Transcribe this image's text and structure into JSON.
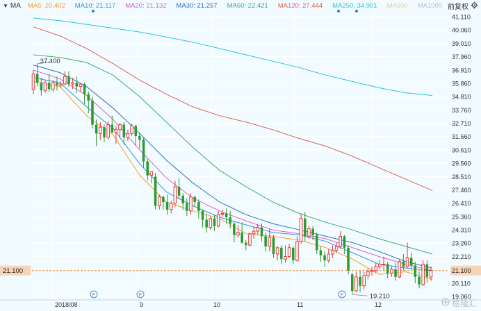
{
  "header": {
    "ma_label": "MA",
    "settings_label": "前复权",
    "legend": [
      {
        "label": "MA5: 20.402",
        "color": "#f3a02a"
      },
      {
        "label": "MA10: 21.117",
        "color": "#3a8fd9"
      },
      {
        "label": "MA20: 21.132",
        "color": "#d65fd0"
      },
      {
        "label": "MA30: 21.257",
        "color": "#2a6fb8"
      },
      {
        "label": "MA60: 22.421",
        "color": "#3dae6a"
      },
      {
        "label": "MA120: 27.444",
        "color": "#e06055"
      },
      {
        "label": "MA250: 34.901",
        "color": "#26c6d9"
      },
      {
        "label": "MA500",
        "color": "#e9d38a"
      },
      {
        "label": "MA1000",
        "color": "#b9b9e3"
      }
    ]
  },
  "watermark": "格隆汇",
  "chart_data": {
    "type": "candlestick",
    "title": "",
    "y_ticks": [
      41.11,
      40.06,
      39.01,
      37.96,
      36.91,
      35.86,
      34.81,
      33.76,
      32.71,
      31.66,
      30.61,
      29.56,
      28.51,
      27.46,
      26.41,
      25.36,
      24.31,
      23.26,
      22.21,
      20.11,
      19.06
    ],
    "y_tick_labels": [
      "41.110",
      "40.060",
      "39.010",
      "37.960",
      "36.910",
      "35.860",
      "34.810",
      "33.760",
      "32.710",
      "31.660",
      "30.610",
      "29.560",
      "28.510",
      "27.460",
      "26.410",
      "25.360",
      "24.310",
      "23.260",
      "22.210",
      "20.110",
      "19.060"
    ],
    "ylim": [
      18.9,
      41.2
    ],
    "x_labels": [
      "2018/08",
      "9",
      "10",
      "11",
      "12"
    ],
    "current_price": {
      "value": 21.1,
      "label": "21.100",
      "color": "#f08a28"
    },
    "annotations": [
      {
        "label": "37.400",
        "type": "high",
        "value": 37.4
      },
      {
        "label": "19.210",
        "type": "low",
        "value": 19.21
      }
    ],
    "event_markers": [
      "E",
      "E",
      "E"
    ],
    "colors": {
      "up": "#e2353a",
      "down": "#2c9a2c",
      "grid": "#ffffff",
      "bg": "#f2fbff",
      "cur_line": "#f08a28"
    },
    "candles": [
      [
        35.4,
        36.9,
        36.6,
        35.0
      ],
      [
        36.6,
        37.4,
        35.9,
        35.6
      ],
      [
        35.9,
        36.3,
        35.3,
        34.9
      ],
      [
        35.3,
        36.1,
        35.9,
        35.1
      ],
      [
        35.9,
        36.6,
        35.4,
        35.2
      ],
      [
        35.4,
        36.1,
        35.9,
        35.2
      ],
      [
        35.9,
        36.4,
        35.7,
        35.3
      ],
      [
        35.7,
        36.0,
        35.8,
        35.5
      ],
      [
        35.8,
        36.8,
        36.4,
        35.7
      ],
      [
        36.4,
        36.8,
        35.8,
        35.6
      ],
      [
        35.8,
        36.3,
        35.9,
        35.4
      ],
      [
        35.9,
        36.4,
        35.6,
        35.1
      ],
      [
        35.6,
        35.9,
        35.8,
        35.2
      ],
      [
        35.8,
        35.9,
        35.0,
        34.2
      ],
      [
        35.0,
        35.2,
        34.5,
        33.5
      ],
      [
        34.5,
        34.8,
        32.6,
        32.3
      ],
      [
        32.6,
        33.0,
        31.9,
        30.9
      ],
      [
        31.9,
        32.8,
        32.4,
        31.4
      ],
      [
        32.4,
        32.6,
        31.6,
        31.2
      ],
      [
        31.6,
        32.9,
        32.6,
        31.4
      ],
      [
        32.6,
        33.3,
        32.0,
        31.9
      ],
      [
        32.0,
        32.5,
        32.2,
        31.1
      ],
      [
        32.2,
        32.7,
        32.6,
        31.6
      ],
      [
        32.6,
        32.8,
        31.6,
        31.0
      ],
      [
        31.6,
        32.2,
        31.9,
        31.3
      ],
      [
        31.9,
        32.7,
        32.5,
        31.7
      ],
      [
        32.5,
        32.6,
        31.7,
        30.9
      ],
      [
        31.7,
        32.0,
        31.4,
        30.7
      ],
      [
        31.4,
        31.6,
        29.7,
        29.2
      ],
      [
        29.7,
        29.9,
        28.6,
        28.2
      ],
      [
        28.6,
        28.8,
        28.9,
        28.0
      ],
      [
        28.5,
        28.8,
        26.2,
        25.9
      ],
      [
        26.2,
        27.1,
        26.9,
        25.9
      ],
      [
        26.9,
        27.0,
        26.5,
        25.9
      ],
      [
        26.5,
        27.1,
        25.9,
        25.5
      ],
      [
        25.9,
        26.6,
        26.4,
        25.6
      ],
      [
        26.4,
        28.2,
        27.7,
        26.1
      ],
      [
        27.7,
        28.4,
        27.0,
        26.7
      ],
      [
        27.0,
        27.2,
        26.4,
        25.9
      ],
      [
        26.4,
        26.8,
        25.8,
        25.4
      ],
      [
        25.8,
        27.2,
        26.9,
        25.5
      ],
      [
        26.9,
        27.0,
        26.5,
        26.1
      ],
      [
        26.5,
        26.7,
        25.8,
        25.2
      ],
      [
        25.8,
        25.9,
        25.1,
        24.5
      ],
      [
        25.1,
        25.6,
        24.5,
        24.1
      ],
      [
        24.5,
        25.4,
        25.2,
        24.3
      ],
      [
        25.2,
        25.5,
        24.6,
        24.2
      ],
      [
        24.6,
        25.8,
        25.5,
        24.5
      ],
      [
        25.5,
        25.9,
        25.6,
        25.3
      ],
      [
        25.6,
        26.0,
        25.3,
        24.8
      ],
      [
        25.3,
        25.8,
        24.8,
        24.4
      ],
      [
        24.8,
        25.0,
        23.9,
        23.3
      ],
      [
        23.9,
        24.7,
        24.1,
        23.7
      ],
      [
        24.1,
        24.9,
        23.3,
        23.2
      ],
      [
        23.3,
        23.5,
        23.1,
        22.7
      ],
      [
        23.1,
        24.1,
        24.0,
        23.0
      ],
      [
        24.0,
        24.6,
        24.2,
        23.6
      ],
      [
        24.2,
        24.8,
        24.5,
        23.9
      ],
      [
        24.5,
        24.8,
        23.8,
        23.4
      ],
      [
        23.8,
        24.1,
        23.0,
        22.6
      ],
      [
        23.0,
        24.4,
        23.7,
        22.6
      ],
      [
        23.7,
        23.9,
        22.4,
        22.1
      ],
      [
        22.4,
        23.0,
        22.9,
        21.9
      ],
      [
        22.9,
        23.1,
        22.0,
        21.6
      ],
      [
        22.0,
        23.1,
        22.2,
        21.7
      ],
      [
        22.2,
        23.2,
        22.9,
        22.1
      ],
      [
        22.9,
        23.0,
        21.9,
        21.6
      ],
      [
        21.9,
        23.8,
        23.4,
        21.8
      ],
      [
        23.4,
        25.6,
        25.2,
        23.2
      ],
      [
        25.2,
        25.7,
        23.8,
        23.4
      ],
      [
        23.8,
        24.6,
        24.4,
        23.6
      ],
      [
        24.4,
        24.6,
        23.9,
        23.5
      ],
      [
        23.9,
        24.1,
        22.7,
        22.4
      ],
      [
        22.7,
        23.0,
        22.3,
        21.8
      ],
      [
        22.3,
        22.6,
        21.9,
        21.4
      ],
      [
        21.9,
        22.8,
        22.4,
        21.7
      ],
      [
        22.4,
        23.1,
        22.7,
        22.1
      ],
      [
        22.7,
        23.3,
        23.0,
        22.5
      ],
      [
        23.0,
        24.2,
        23.8,
        22.8
      ],
      [
        23.8,
        23.9,
        22.9,
        22.4
      ],
      [
        22.9,
        23.1,
        21.1,
        20.8
      ],
      [
        20.8,
        20.9,
        19.5,
        19.2
      ],
      [
        19.5,
        21.0,
        20.6,
        19.4
      ],
      [
        20.6,
        21.1,
        19.9,
        19.4
      ],
      [
        19.9,
        21.0,
        20.7,
        19.6
      ],
      [
        20.7,
        21.3,
        21.0,
        20.4
      ],
      [
        21.0,
        21.4,
        21.1,
        20.7
      ],
      [
        21.1,
        21.7,
        21.4,
        20.9
      ],
      [
        21.4,
        21.9,
        21.6,
        21.2
      ],
      [
        21.6,
        22.2,
        21.6,
        21.1
      ],
      [
        21.6,
        21.8,
        20.9,
        20.5
      ],
      [
        20.9,
        21.4,
        21.2,
        20.6
      ],
      [
        21.2,
        21.7,
        20.6,
        20.3
      ],
      [
        20.6,
        22.0,
        21.8,
        20.5
      ],
      [
        21.8,
        22.4,
        21.4,
        21.1
      ],
      [
        21.4,
        23.3,
        22.1,
        21.3
      ],
      [
        22.1,
        22.5,
        21.5,
        21.2
      ],
      [
        21.5,
        21.8,
        20.6,
        20.1
      ],
      [
        20.6,
        21.0,
        20.0,
        19.7
      ],
      [
        20.0,
        21.9,
        21.6,
        19.9
      ],
      [
        21.6,
        21.9,
        20.6,
        20.1
      ],
      [
        20.6,
        21.4,
        21.1,
        20.3
      ]
    ],
    "ma_series": [
      {
        "name": "MA250",
        "color": "#26c6d9",
        "values": [
          41.0,
          40.8,
          40.5,
          40.2,
          39.9,
          39.5,
          39.1,
          38.6,
          38.1,
          37.6,
          37.1,
          36.5,
          36.0,
          35.5,
          35.1,
          34.9
        ]
      },
      {
        "name": "MA120",
        "color": "#e06055",
        "values": [
          40.3,
          39.6,
          38.6,
          37.4,
          36.1,
          35.0,
          34.0,
          33.3,
          32.8,
          32.2,
          31.5,
          30.9,
          30.1,
          29.2,
          28.3,
          27.4
        ]
      },
      {
        "name": "MA60",
        "color": "#3dae6a",
        "values": [
          38.1,
          37.9,
          37.5,
          36.5,
          34.8,
          32.8,
          30.8,
          29.0,
          27.7,
          26.5,
          25.6,
          24.9,
          24.3,
          23.6,
          23.0,
          22.4
        ]
      },
      {
        "name": "MA30",
        "color": "#2a6fb8",
        "values": [
          37.3,
          36.7,
          35.6,
          33.9,
          31.9,
          29.8,
          28.0,
          26.5,
          25.5,
          24.8,
          24.3,
          23.8,
          23.3,
          22.6,
          21.8,
          21.3
        ]
      },
      {
        "name": "MA20",
        "color": "#d65fd0",
        "values": [
          36.9,
          36.2,
          34.9,
          33.0,
          30.6,
          28.4,
          26.8,
          25.8,
          25.0,
          24.3,
          24.0,
          23.6,
          22.9,
          22.2,
          21.6,
          21.1
        ]
      },
      {
        "name": "MA10",
        "color": "#3a8fd9",
        "values": [
          36.3,
          35.9,
          34.0,
          32.3,
          29.5,
          27.3,
          26.2,
          25.3,
          24.7,
          24.1,
          23.9,
          23.4,
          22.5,
          21.6,
          21.3,
          21.1
        ]
      },
      {
        "name": "MA5",
        "color": "#f3a02a",
        "values": [
          36.0,
          35.6,
          33.3,
          31.8,
          28.6,
          26.5,
          25.8,
          25.2,
          24.0,
          23.8,
          23.5,
          22.9,
          22.0,
          20.8,
          21.0,
          20.4
        ]
      }
    ]
  }
}
